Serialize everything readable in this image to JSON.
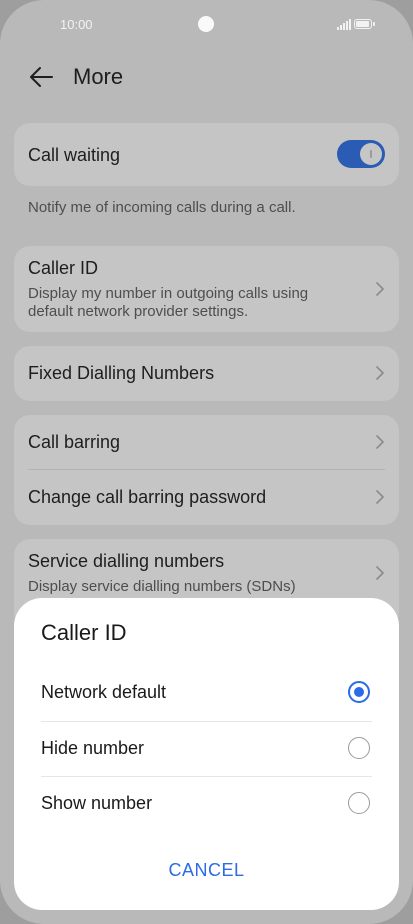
{
  "status_bar": {
    "time": "10:00"
  },
  "header": {
    "title": "More"
  },
  "call_waiting": {
    "label": "Call waiting",
    "enabled": true,
    "hint": "Notify me of incoming calls during a call."
  },
  "caller_id": {
    "label": "Caller ID",
    "sub1": "Display my number in outgoing calls using",
    "sub2": "default network provider settings."
  },
  "fdn": {
    "label": "Fixed Dialling Numbers"
  },
  "barring": {
    "label": "Call barring",
    "password_label": "Change call barring password"
  },
  "sdn": {
    "label": "Service dialling numbers",
    "sub": "Display service dialling numbers (SDNs)"
  },
  "dialog": {
    "title": "Caller ID",
    "options": [
      {
        "label": "Network default",
        "selected": true
      },
      {
        "label": "Hide number",
        "selected": false
      },
      {
        "label": "Show number",
        "selected": false
      }
    ],
    "cancel": "CANCEL"
  },
  "colors": {
    "accent": "#2a6be6",
    "toggle_on": "#2a5cb4",
    "scrim_background": "#b9b9b9"
  }
}
